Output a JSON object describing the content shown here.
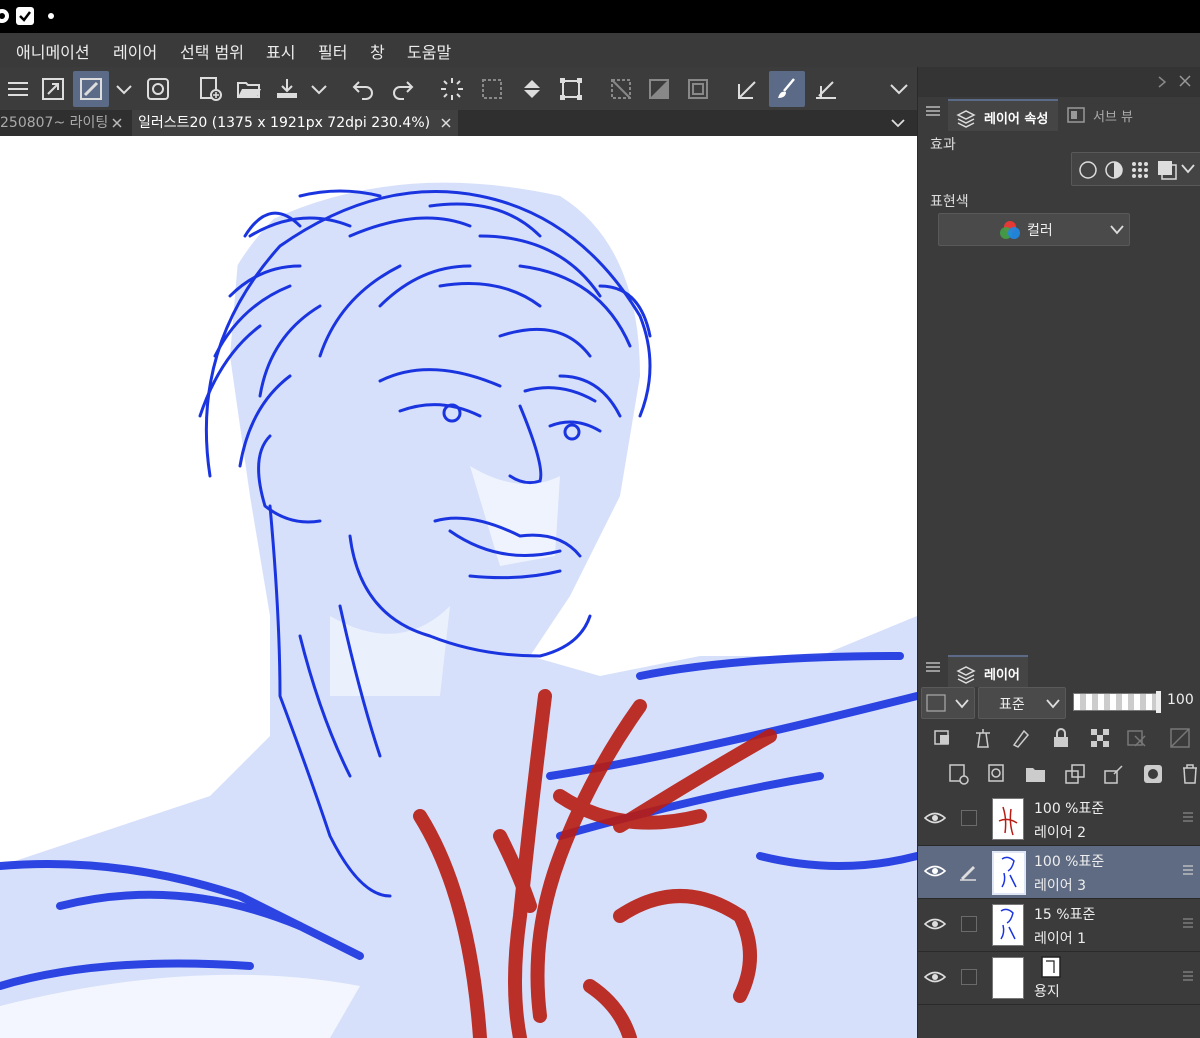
{
  "menu": [
    "애니메이션",
    "레이어",
    "선택 범위",
    "표시",
    "필터",
    "창",
    "도움말"
  ],
  "tabs": {
    "inactive": "250807~ 라이팅",
    "active": "일러스트20 (1375 x 1921px 72dpi 230.4%)"
  },
  "panel": {
    "tab_layer_props": "레이어 속성",
    "tab_sub_view": "서브 뷰",
    "effect_label": "효과",
    "color_label": "표현색",
    "color_value": "컬러"
  },
  "layers_panel": {
    "title": "레이어",
    "blend_mode": "표준",
    "opacity": "100",
    "layers": [
      {
        "mode": "100 %표준",
        "name": "레이어 2",
        "thumb": "red",
        "selected": false
      },
      {
        "mode": "100 %표준",
        "name": "레이어 3",
        "thumb": "blue",
        "selected": true
      },
      {
        "mode": "15 %표준",
        "name": "레이어 1",
        "thumb": "blue",
        "selected": false
      },
      {
        "mode": "",
        "name": "용지",
        "thumb": "paper",
        "selected": false
      }
    ]
  },
  "colors": {
    "accent": "#5b6a86",
    "sketch_blue": "#1a35e0",
    "sketch_light": "#d4defa",
    "sketch_red": "#b81c12"
  }
}
